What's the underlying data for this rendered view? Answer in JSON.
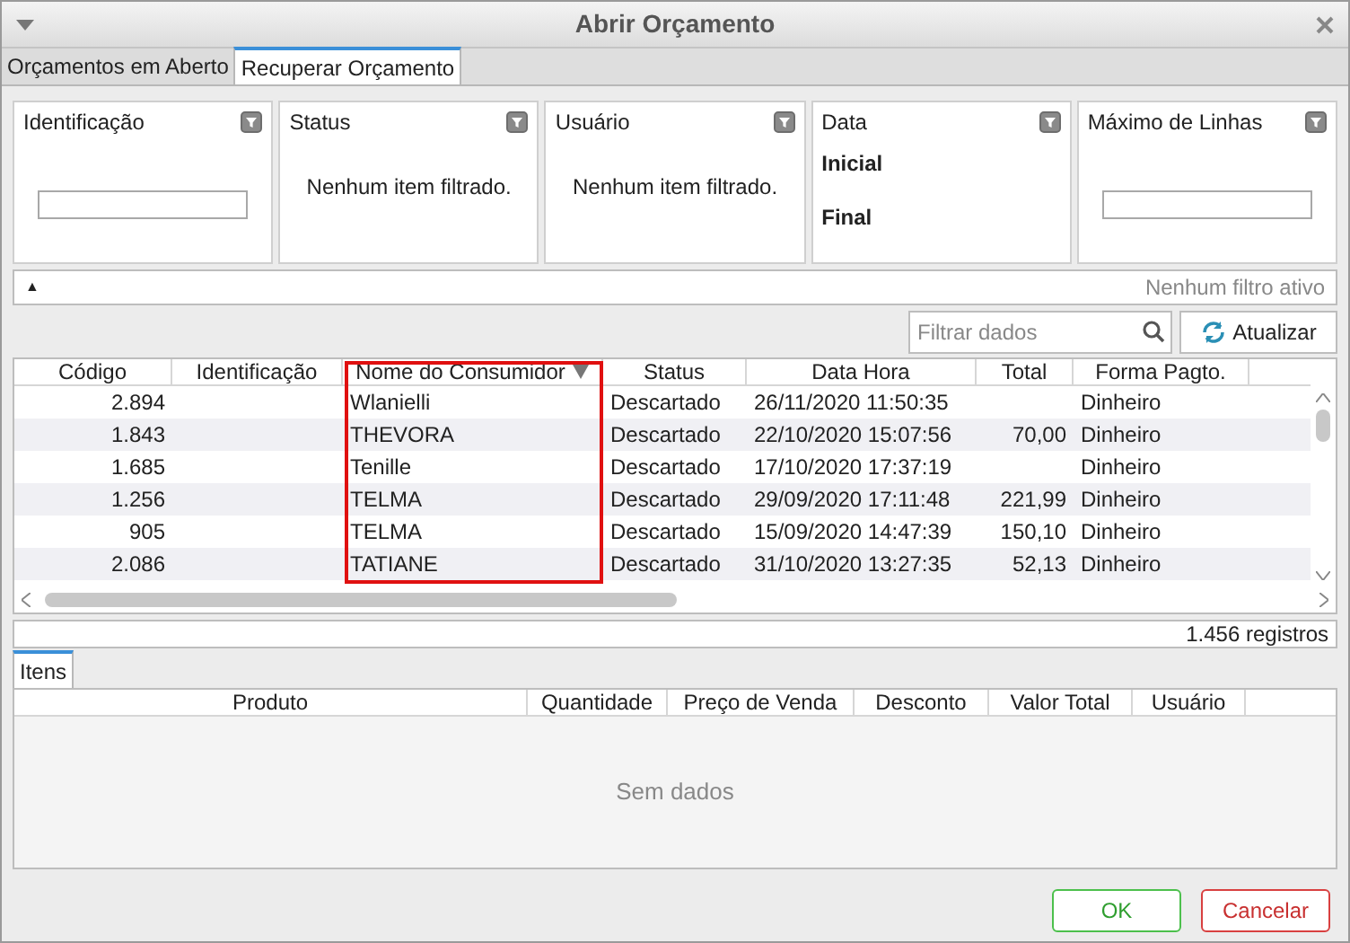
{
  "window": {
    "title": "Abrir Orçamento"
  },
  "tabs": [
    {
      "label": "Orçamentos em Aberto",
      "selected": false
    },
    {
      "label": "Recuperar Orçamento",
      "selected": true
    }
  ],
  "filters": [
    {
      "kind": "input",
      "title": "Identificação"
    },
    {
      "kind": "list",
      "title": "Status",
      "message": "Nenhum item filtrado."
    },
    {
      "kind": "list",
      "title": "Usuário",
      "message": "Nenhum item filtrado."
    },
    {
      "kind": "date",
      "title": "Data",
      "labels": [
        "Inicial",
        "Final"
      ]
    },
    {
      "kind": "input",
      "title": "Máximo de Linhas"
    }
  ],
  "filter_bar": {
    "toggle": "▲",
    "status": "Nenhum filtro ativo"
  },
  "search": {
    "placeholder": "Filtrar dados"
  },
  "refresh_button": "Atualizar",
  "table": {
    "columns": [
      {
        "label": "Código",
        "sorted": false,
        "highlighted": false
      },
      {
        "label": "Identificação",
        "sorted": false,
        "highlighted": false
      },
      {
        "label": "Nome do Consumidor",
        "sorted": true,
        "highlighted": true
      },
      {
        "label": "Status",
        "sorted": false,
        "highlighted": false
      },
      {
        "label": "Data Hora",
        "sorted": false,
        "highlighted": false
      },
      {
        "label": "Total",
        "sorted": false,
        "highlighted": false
      },
      {
        "label": "Forma Pagto.",
        "sorted": false,
        "highlighted": false
      }
    ],
    "rows": [
      [
        "2.894",
        "",
        "Wlanielli",
        "Descartado",
        "26/11/2020 11:50:35",
        "",
        "Dinheiro"
      ],
      [
        "1.843",
        "",
        "THEVORA",
        "Descartado",
        "22/10/2020 15:07:56",
        "70,00",
        "Dinheiro"
      ],
      [
        "1.685",
        "",
        "Tenille",
        "Descartado",
        "17/10/2020 17:37:19",
        "",
        "Dinheiro"
      ],
      [
        "1.256",
        "",
        "TELMA",
        "Descartado",
        "29/09/2020 17:11:48",
        "221,99",
        "Dinheiro"
      ],
      [
        "905",
        "",
        "TELMA",
        "Descartado",
        "15/09/2020 14:47:39",
        "150,10",
        "Dinheiro"
      ],
      [
        "2.086",
        "",
        "TATIANE",
        "Descartado",
        "31/10/2020 13:27:35",
        "52,13",
        "Dinheiro"
      ]
    ]
  },
  "records": "1.456 registros",
  "items_tab": {
    "label": "Itens",
    "selected": true
  },
  "items_table": {
    "columns": [
      "Produto",
      "Quantidade",
      "Preço de Venda",
      "Desconto",
      "Valor Total",
      "Usuário"
    ],
    "empty": "Sem dados"
  },
  "buttons": [
    {
      "label": "OK",
      "kind": "ok"
    },
    {
      "label": "Cancelar",
      "kind": "cancel"
    }
  ]
}
